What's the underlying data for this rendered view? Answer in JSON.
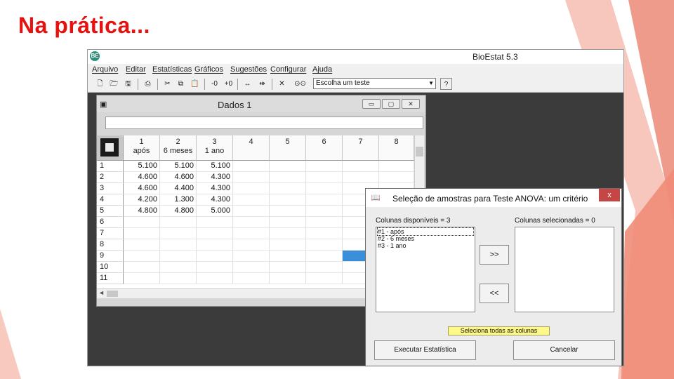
{
  "slide": {
    "title": "Na prática..."
  },
  "app": {
    "title": "BioEstat 5.3",
    "menu": [
      "Arquivo",
      "Editar",
      "Estatísticas",
      "Gráficos",
      "Sugestões",
      "Configurar",
      "Ajuda"
    ],
    "toolbar": {
      "test_select_value": "Escolha um teste",
      "zoom_in": "+0",
      "zoom_out": "-0"
    }
  },
  "data_window": {
    "title": "Dados 1",
    "columns": [
      {
        "num": "1",
        "label": "após"
      },
      {
        "num": "2",
        "label": "6 meses"
      },
      {
        "num": "3",
        "label": "1 ano"
      },
      {
        "num": "4",
        "label": ""
      },
      {
        "num": "5",
        "label": ""
      },
      {
        "num": "6",
        "label": ""
      },
      {
        "num": "7",
        "label": ""
      },
      {
        "num": "8",
        "label": ""
      }
    ],
    "rows": [
      {
        "n": "1",
        "values": [
          "5.100",
          "5.100",
          "5.100"
        ]
      },
      {
        "n": "2",
        "values": [
          "4.600",
          "4.600",
          "4.300"
        ]
      },
      {
        "n": "3",
        "values": [
          "4.600",
          "4.400",
          "4.300"
        ]
      },
      {
        "n": "4",
        "values": [
          "4.200",
          "1.300",
          "4.300"
        ]
      },
      {
        "n": "5",
        "values": [
          "4.800",
          "4.800",
          "5.000"
        ]
      },
      {
        "n": "6",
        "values": [
          "",
          "",
          ""
        ]
      },
      {
        "n": "7",
        "values": [
          "",
          "",
          ""
        ]
      },
      {
        "n": "8",
        "values": [
          "",
          "",
          ""
        ]
      },
      {
        "n": "9",
        "values": [
          "",
          "",
          ""
        ]
      },
      {
        "n": "10",
        "values": [
          "",
          "",
          ""
        ]
      },
      {
        "n": "11",
        "values": [
          "",
          "",
          ""
        ]
      }
    ]
  },
  "dialog": {
    "title": "Seleção de amostras para Teste ANOVA: um critério",
    "close_label": "x",
    "available_label": "Colunas disponíveis = 3",
    "selected_label": "Colunas selecionadas = 0",
    "available_items": [
      "#1  -  após",
      "#2  -  6 meses",
      "#3  -  1 ano"
    ],
    "add_button": ">>",
    "remove_button": "<<",
    "select_all_button": "Seleciona todas as colunas",
    "run_button": "Executar Estatística",
    "cancel_button": "Cancelar"
  },
  "colors": {
    "title_red": "#e5120f",
    "accent_salmon": "#f1998a",
    "selection_blue": "#3a8fd8"
  }
}
